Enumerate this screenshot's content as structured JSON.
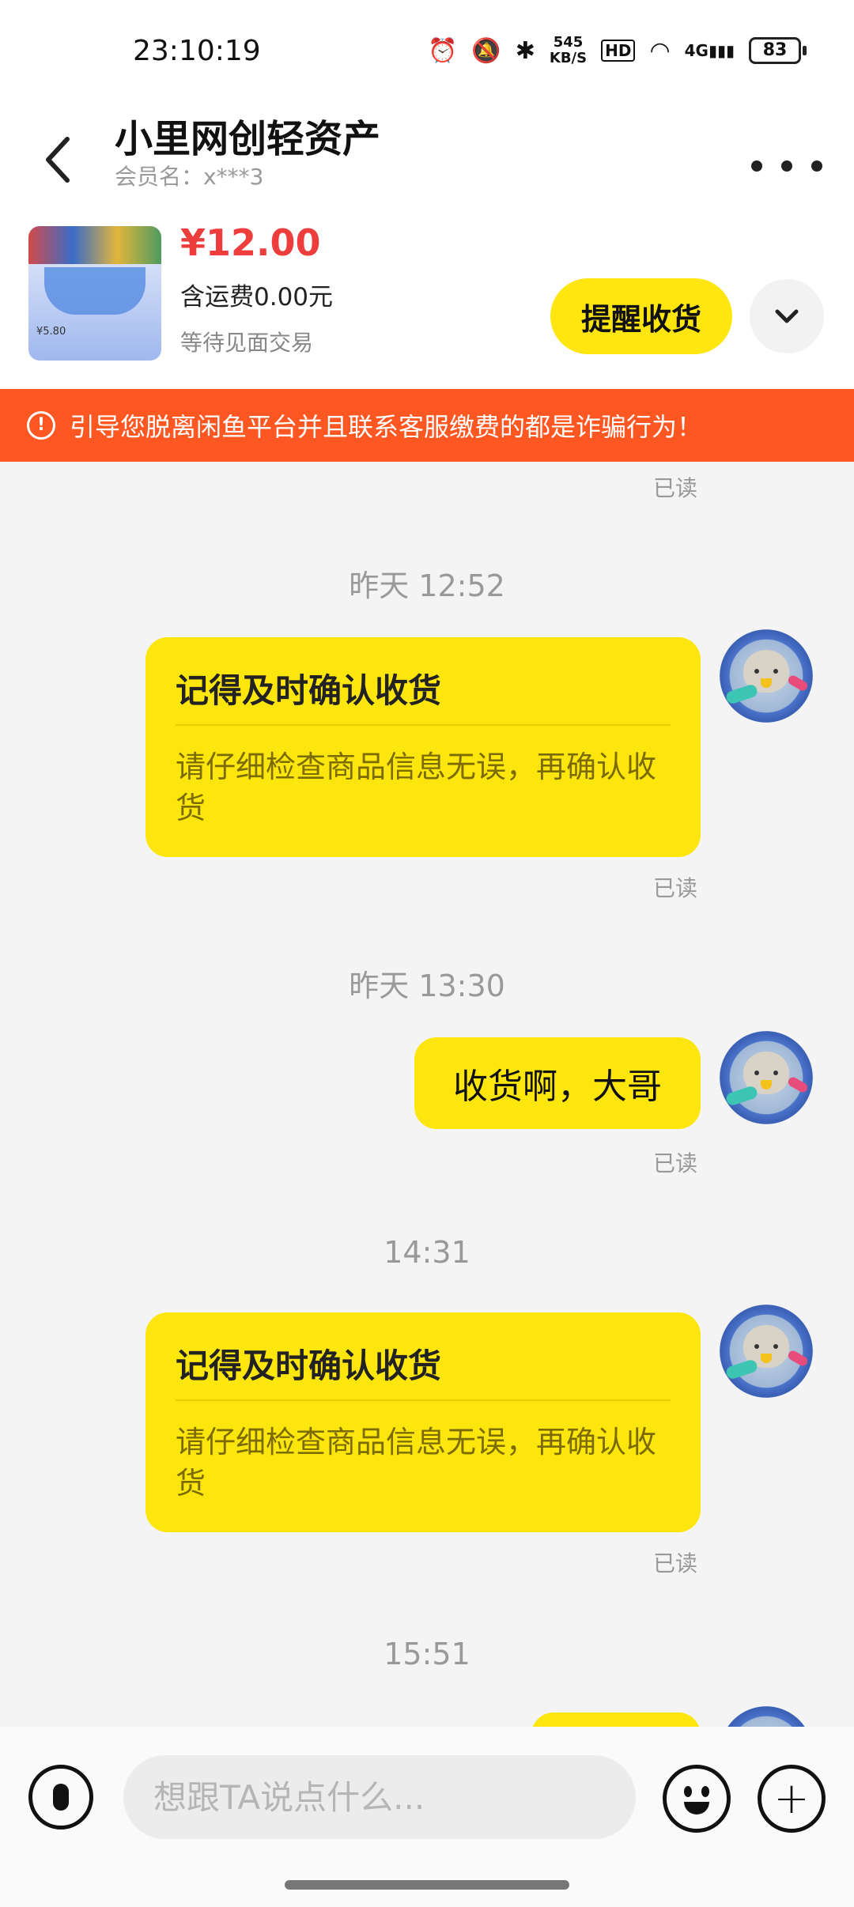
{
  "status_bar": {
    "time": "23:10:19",
    "net_speed_value": "545",
    "net_speed_unit": "KB/S",
    "hd": "HD",
    "signal": "4G",
    "battery": "83"
  },
  "header": {
    "title": "小里网创轻资产",
    "member": "会员名：x***3"
  },
  "product": {
    "price": "¥12.00",
    "shipping": "含运费0.00元",
    "trade_status": "等待见面交易",
    "remind_button": "提醒收货",
    "thumb_tag": "¥5.80"
  },
  "warning": {
    "icon": "!",
    "text": "引导您脱离闲鱼平台并且联系客服缴费的都是诈骗行为！"
  },
  "chat": {
    "read_label": "已读",
    "messages": [
      {
        "time": "昨天 12:52",
        "type": "card",
        "title": "记得及时确认收货",
        "body": "请仔细检查商品信息无误，再确认收货"
      },
      {
        "time": "昨天 13:30",
        "type": "text",
        "text": "收货啊，大哥"
      },
      {
        "time": "14:31",
        "type": "card",
        "title": "记得及时确认收货",
        "body": "请仔细检查商品信息无误，再确认收货"
      },
      {
        "time": "15:51",
        "type": "partial"
      }
    ]
  },
  "input": {
    "placeholder": "想跟TA说点什么..."
  },
  "icons": [
    "back-arrow-icon",
    "more-icon",
    "chevron-down-icon",
    "warning-icon",
    "avatar-icon",
    "mic-icon",
    "emoji-icon",
    "plus-icon"
  ]
}
